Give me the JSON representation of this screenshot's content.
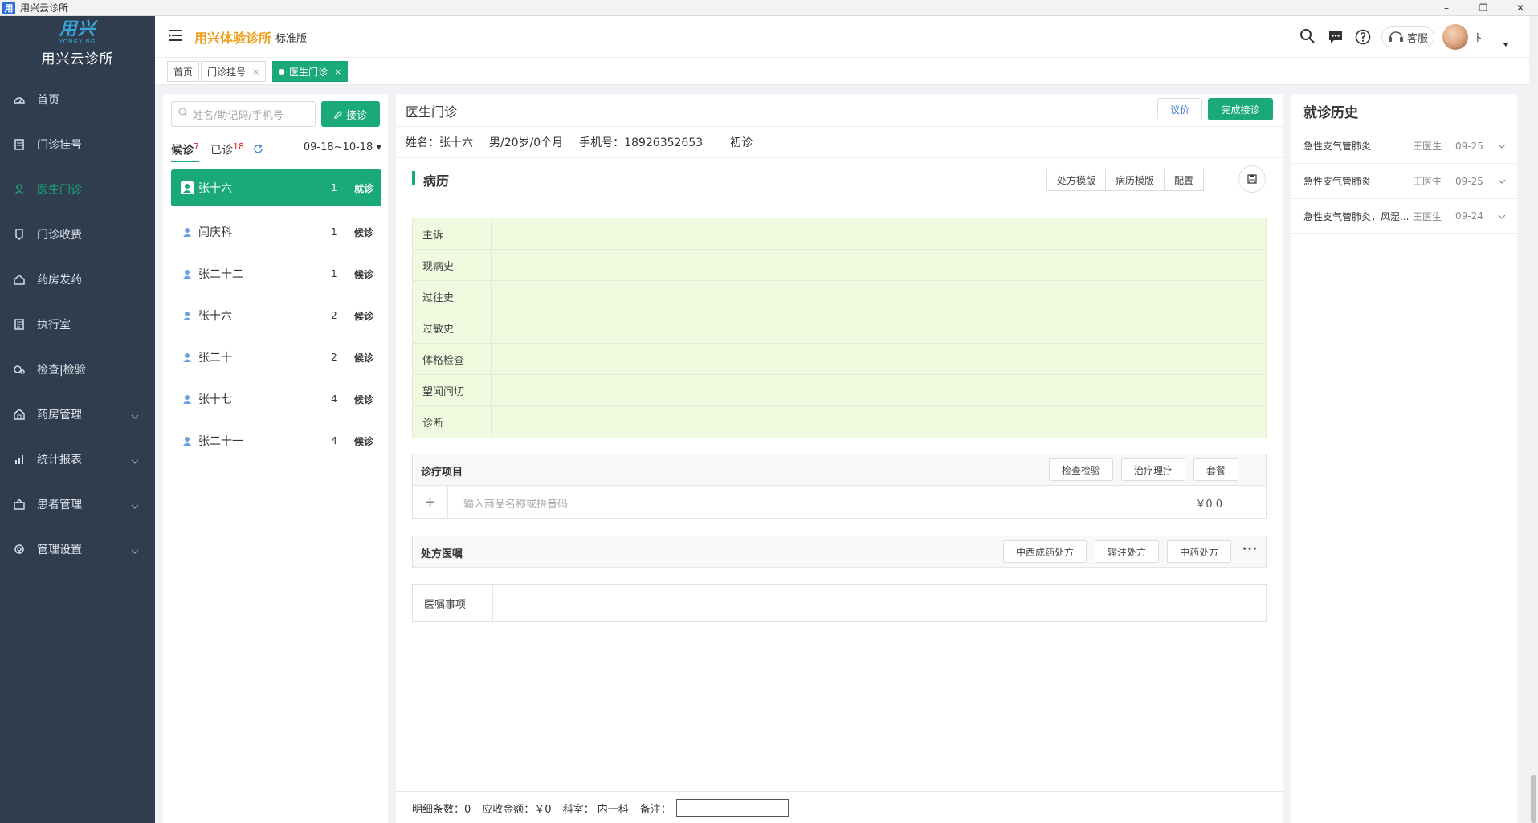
{
  "window": {
    "title": "用兴云诊所",
    "app_icon": "用",
    "minimize": "–",
    "restore": "❐",
    "close": "✕"
  },
  "logo": {
    "mark": "用兴",
    "sub": "YONGXING",
    "name": "用兴云诊所"
  },
  "sidebar": {
    "items": [
      {
        "label": "首页",
        "icon": "dashboard-icon"
      },
      {
        "label": "门诊挂号",
        "icon": "register-icon"
      },
      {
        "label": "医生门诊",
        "icon": "doctor-icon"
      },
      {
        "label": "门诊收费",
        "icon": "charge-icon"
      },
      {
        "label": "药房发药",
        "icon": "pharmacy-icon"
      },
      {
        "label": "执行室",
        "icon": "execution-icon"
      },
      {
        "label": "检查|检验",
        "icon": "lab-icon"
      },
      {
        "label": "药房管理",
        "icon": "warehouse-icon"
      },
      {
        "label": "统计报表",
        "icon": "chart-icon"
      },
      {
        "label": "患者管理",
        "icon": "patient-icon"
      },
      {
        "label": "管理设置",
        "icon": "settings-icon"
      }
    ],
    "active_color": "#1aa97a"
  },
  "header": {
    "brand": "用兴体验诊所",
    "edition": "标准版",
    "kefu": "客服",
    "user": "卞"
  },
  "tabs": [
    {
      "label": "首页"
    },
    {
      "label": "门诊挂号",
      "close": "×"
    },
    {
      "label": "医生门诊",
      "close": "×"
    }
  ],
  "queue": {
    "search_placeholder": "姓名/助记码/手机号",
    "accept_button": "接诊",
    "tab_waiting": "候诊",
    "waiting_count": "7",
    "tab_done": "已诊",
    "done_count": "18",
    "date_range": "09-18~10-18",
    "rows": [
      {
        "name": "张十六",
        "num": "1",
        "status": "就诊"
      },
      {
        "name": "闫庆科",
        "num": "1",
        "status": "候诊"
      },
      {
        "name": "张二十二",
        "num": "1",
        "status": "候诊"
      },
      {
        "name": "张十六",
        "num": "2",
        "status": "候诊"
      },
      {
        "name": "张二十",
        "num": "2",
        "status": "候诊"
      },
      {
        "name": "张十七",
        "num": "4",
        "status": "候诊"
      },
      {
        "name": "张二十一",
        "num": "4",
        "status": "候诊"
      }
    ]
  },
  "main": {
    "title": "医生门诊",
    "price_button": "议价",
    "finish_button": "完成接诊",
    "patient": {
      "name": "姓名：张十六",
      "gender_age": "男/20岁/0个月",
      "phone": "手机号：18926352653",
      "visit_type": "初诊"
    },
    "record_title": "病历",
    "record_buttons": [
      "处方模版",
      "病历模版",
      "配置"
    ],
    "record_fields": [
      "主诉",
      "现病史",
      "过往史",
      "过敏史",
      "体格检查",
      "望闻问切",
      "诊断"
    ],
    "treatment": {
      "title": "诊疗项目",
      "buttons": [
        "检查检验",
        "治疗理疗",
        "套餐"
      ],
      "add": "+",
      "placeholder": "输入商品名称或拼音码",
      "price": "￥0.0"
    },
    "prescription": {
      "title": "处方医嘱",
      "buttons": [
        "中西成药处方",
        "输注处方",
        "中药处方"
      ],
      "more": "···"
    },
    "advice_label": "医嘱事项",
    "footer": {
      "detail_count": "明细条数：0",
      "amount": "应收金额：￥0",
      "dept": "科室： 内一科",
      "remark": "备注："
    }
  },
  "history": {
    "title": "就诊历史",
    "rows": [
      {
        "diagnosis": "急性支气管肺炎",
        "doctor": "王医生",
        "date": "09-25"
      },
      {
        "diagnosis": "急性支气管肺炎",
        "doctor": "王医生",
        "date": "09-25"
      },
      {
        "diagnosis": "急性支气管肺炎，风湿...",
        "doctor": "王医生",
        "date": "09-24"
      }
    ]
  }
}
